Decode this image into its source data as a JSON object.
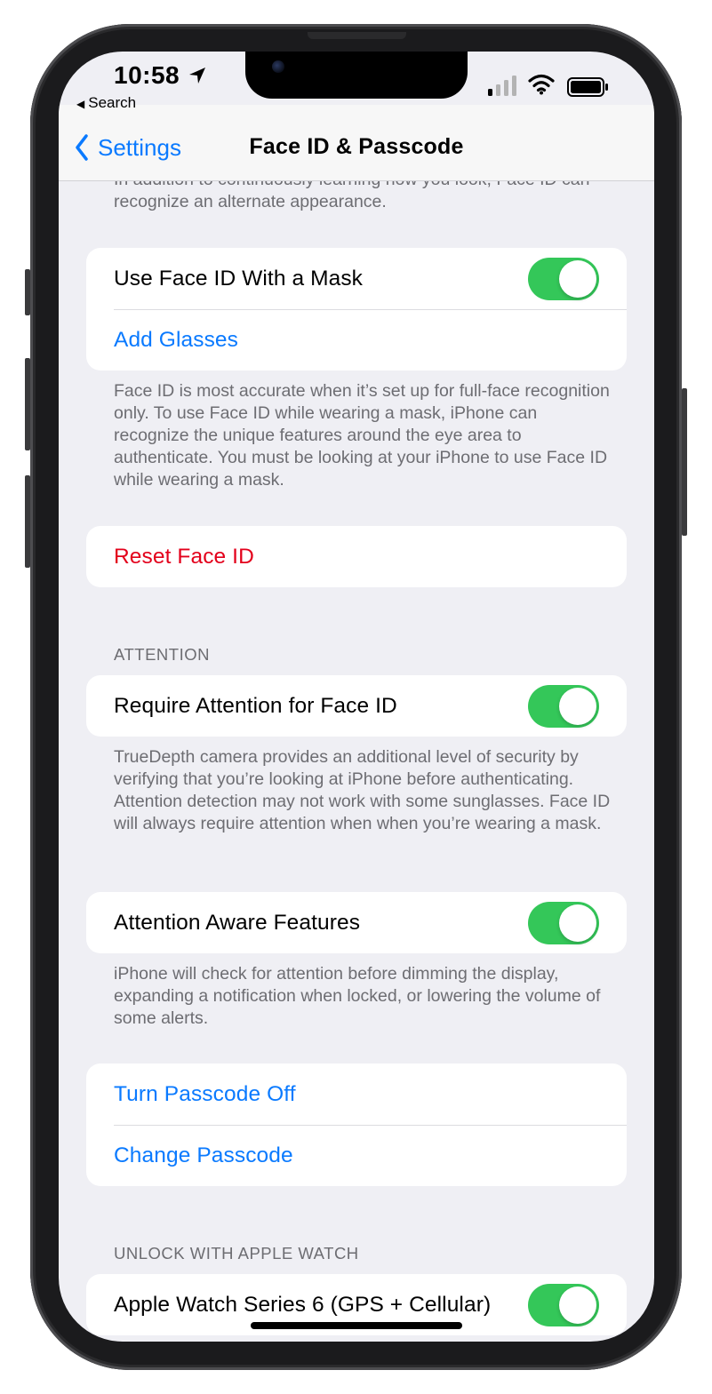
{
  "status_bar": {
    "time": "10:58",
    "back_app": "Search",
    "back_app_icon": "back-triangle-icon",
    "location_icon": "location-arrow-icon",
    "signal_icon": "cellular-signal-icon",
    "wifi_icon": "wifi-icon",
    "battery_icon": "battery-icon"
  },
  "nav": {
    "back_label": "Settings",
    "back_icon": "chevron-left-icon",
    "title": "Face ID & Passcode"
  },
  "content": {
    "intro_text": "In addition to continuously learning how you look, Face ID can recognize an alternate appearance.",
    "mask_group": {
      "mask_label": "Use Face ID With a Mask",
      "mask_on": true,
      "add_glasses_label": "Add Glasses"
    },
    "mask_footer": "Face ID is most accurate when it’s set up for full-face recognition only. To use Face ID while wearing a mask, iPhone can recognize the unique features around the eye area to authenticate. You must be looking at your iPhone to use Face ID while wearing a mask.",
    "reset_label": "Reset Face ID",
    "attention_header": "ATTENTION",
    "require_attention_label": "Require Attention for Face ID",
    "require_attention_on": true,
    "attention_footer": "TrueDepth camera provides an additional level of security by verifying that you’re looking at iPhone before authenticating. Attention detection may not work with some sunglasses. Face ID will always require attention when when you’re wearing a mask.",
    "aware_label": "Attention Aware Features",
    "aware_on": true,
    "aware_footer": "iPhone will check for attention before dimming the display, expanding a notification when locked, or lowering the volume of some alerts.",
    "passcode_group": {
      "turn_off_label": "Turn Passcode Off",
      "change_label": "Change Passcode"
    },
    "watch_header": "UNLOCK WITH APPLE WATCH",
    "watch_label": "Apple Watch Series 6 (GPS + Cellular)",
    "watch_on": true
  },
  "colors": {
    "accent_blue": "#0A7AFF",
    "destructive_red": "#E3001B",
    "toggle_green": "#34C759",
    "grouped_background": "#EFEFF4"
  }
}
